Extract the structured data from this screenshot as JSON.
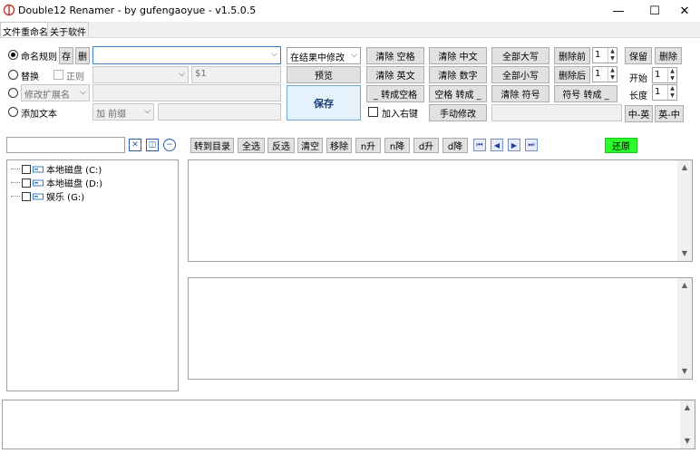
{
  "window": {
    "title": "Double12 Renamer - by gufengaoyue - v1.5.0.5",
    "minimize": "—",
    "maximize": "☐",
    "close": "✕"
  },
  "tabs": [
    {
      "label": "文件重命名",
      "active": true
    },
    {
      "label": "关于软件",
      "active": false
    }
  ],
  "options": {
    "naming_rule": {
      "label": "命名规则",
      "selected": true,
      "save_btn": "存",
      "delete_btn": "删",
      "value": ""
    },
    "replace": {
      "label": "替换",
      "selected": false,
      "regex_label": "正则",
      "regex_checked": false,
      "find_value": "",
      "replace_value": "$1"
    },
    "ext": {
      "label": "修改扩展名",
      "selected": false,
      "value": ""
    },
    "add_text": {
      "label": "添加文本",
      "selected": false,
      "position": "加 前缀",
      "value": ""
    }
  },
  "mode_select": {
    "value": "在结果中修改"
  },
  "preview_btn": "预览",
  "save_btn": "保存",
  "right_click_label": "加入右键",
  "right_click_checked": false,
  "actions": {
    "row1": [
      "清除 空格",
      "清除 中文",
      "全部大写",
      "删除前"
    ],
    "row2": [
      "清除 英文",
      "清除 数字",
      "全部小写",
      "删除后"
    ],
    "row3": [
      "_ 转成空格",
      "空格 转成 _",
      "清除 符号",
      "符号 转成 _"
    ],
    "manual": "手动修改",
    "manual_value": ""
  },
  "spins": {
    "delete_before": "1",
    "delete_after": "1",
    "start": "1",
    "length": "1"
  },
  "keep_btn": "保留",
  "remove_btn": "删除",
  "start_label": "开始",
  "length_label": "长度",
  "zh_en_btn": "中-英",
  "en_zh_btn": "英-中",
  "path_input": "",
  "toolbar": [
    "转到目录",
    "全选",
    "反选",
    "清空",
    "移除",
    "n升",
    "n降",
    "d升",
    "d降"
  ],
  "restore_btn": "还原",
  "drives": [
    {
      "label": "本地磁盘 (C:)"
    },
    {
      "label": "本地磁盘 (D:)"
    },
    {
      "label": "娱乐 (G:)"
    }
  ],
  "colors": {
    "accent": "#3c7fc1",
    "restore": "#2bff2b"
  }
}
